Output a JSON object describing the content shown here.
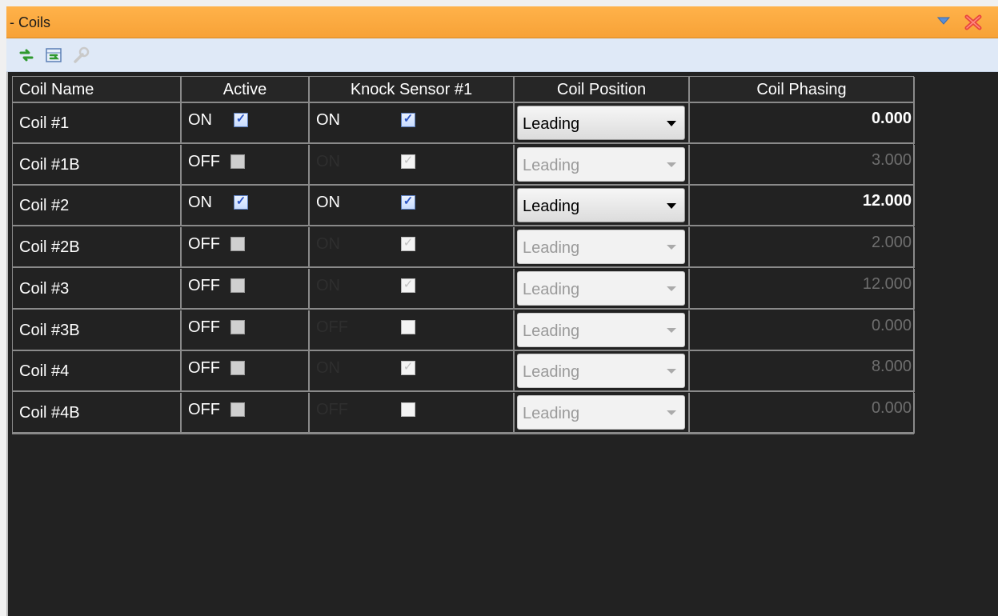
{
  "window": {
    "title": "- Coils",
    "dropdown_icon": "chevron-down-icon",
    "close_icon": "close-icon"
  },
  "toolbar": {
    "tools": [
      {
        "name": "refresh-icon",
        "enabled": true
      },
      {
        "name": "import-icon",
        "enabled": true
      },
      {
        "name": "wrench-icon",
        "enabled": false
      }
    ]
  },
  "grid": {
    "columns": [
      "Coil Name",
      "Active",
      "Knock Sensor #1",
      "Coil Position",
      "Coil Phasing"
    ],
    "rows": [
      {
        "name": "Coil #1",
        "active_text": "ON",
        "active": true,
        "ks_text": "ON",
        "ks_checked": true,
        "ks_enabled": true,
        "position": "Leading",
        "position_enabled": true,
        "phasing": "0.000",
        "phasing_enabled": true
      },
      {
        "name": "Coil #1B",
        "active_text": "OFF",
        "active": false,
        "ks_text": "ON",
        "ks_checked": true,
        "ks_enabled": false,
        "position": "Leading",
        "position_enabled": false,
        "phasing": "3.000",
        "phasing_enabled": false
      },
      {
        "name": "Coil #2",
        "active_text": "ON",
        "active": true,
        "ks_text": "ON",
        "ks_checked": true,
        "ks_enabled": true,
        "position": "Leading",
        "position_enabled": true,
        "phasing": "12.000",
        "phasing_enabled": true
      },
      {
        "name": "Coil #2B",
        "active_text": "OFF",
        "active": false,
        "ks_text": "ON",
        "ks_checked": true,
        "ks_enabled": false,
        "position": "Leading",
        "position_enabled": false,
        "phasing": "2.000",
        "phasing_enabled": false
      },
      {
        "name": "Coil #3",
        "active_text": "OFF",
        "active": false,
        "ks_text": "ON",
        "ks_checked": true,
        "ks_enabled": false,
        "position": "Leading",
        "position_enabled": false,
        "phasing": "12.000",
        "phasing_enabled": false
      },
      {
        "name": "Coil #3B",
        "active_text": "OFF",
        "active": false,
        "ks_text": "OFF",
        "ks_checked": false,
        "ks_enabled": false,
        "position": "Leading",
        "position_enabled": false,
        "phasing": "0.000",
        "phasing_enabled": false
      },
      {
        "name": "Coil #4",
        "active_text": "OFF",
        "active": false,
        "ks_text": "ON",
        "ks_checked": true,
        "ks_enabled": false,
        "position": "Leading",
        "position_enabled": false,
        "phasing": "8.000",
        "phasing_enabled": false
      },
      {
        "name": "Coil #4B",
        "active_text": "OFF",
        "active": false,
        "ks_text": "OFF",
        "ks_checked": false,
        "ks_enabled": false,
        "position": "Leading",
        "position_enabled": false,
        "phasing": "0.000",
        "phasing_enabled": false
      }
    ]
  }
}
